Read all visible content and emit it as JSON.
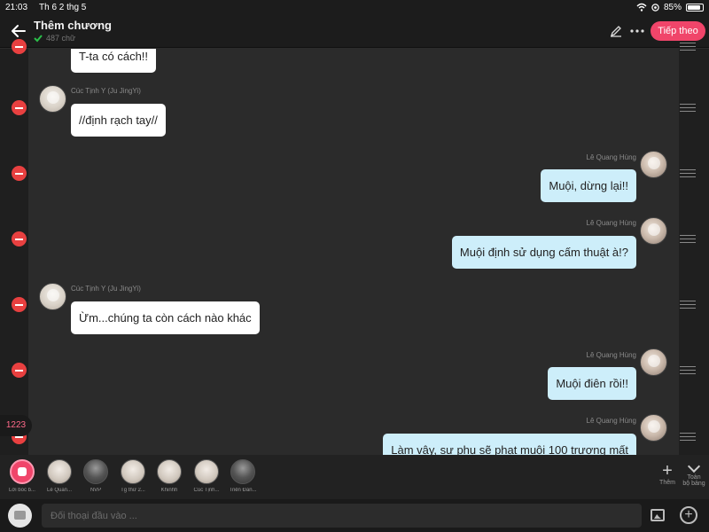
{
  "status_bar": {
    "time": "21:03",
    "date": "Th 6 2 thg 5",
    "battery": "85%"
  },
  "header": {
    "title": "Thêm chương",
    "word_count": "487 chữ",
    "next_label": "Tiếp theo"
  },
  "chat": {
    "messages": [
      {
        "side": "left",
        "speaker": "",
        "text": "T-ta có cách!!"
      },
      {
        "side": "left",
        "speaker": "Cúc Tịnh Y (Ju JingYi)",
        "text": "//định rạch tay//"
      },
      {
        "side": "right",
        "speaker": "Lê Quang Hùng",
        "text": "Muội, dừng lại!!"
      },
      {
        "side": "right",
        "speaker": "Lê Quang Hùng",
        "text": "Muội định sử dụng cấm thuật à!?"
      },
      {
        "side": "left",
        "speaker": "Cúc Tịnh Y (Ju JingYi)",
        "text": "Ừm...chúng ta còn cách nào khác"
      },
      {
        "side": "right",
        "speaker": "Lê Quang Hùng",
        "text": "Muội điên rồi!!"
      },
      {
        "side": "right",
        "speaker": "Lê Quang Hùng",
        "text": "Làm vậy, sư phụ sẽ phạt muội 100 trượng mất"
      }
    ],
    "counter_badge": "1223"
  },
  "characters": [
    {
      "label": "Lời bốc b..."
    },
    {
      "label": "Lê Quan..."
    },
    {
      "label": "NVP"
    },
    {
      "label": "Tg thứ 2..."
    },
    {
      "label": "Khinhh"
    },
    {
      "label": "Cúc Tịnh..."
    },
    {
      "label": "Triển Đán..."
    }
  ],
  "character_actions": {
    "add_label": "Thêm",
    "all_label_1": "Toàn",
    "all_label_2": "bộ bảng"
  },
  "input": {
    "placeholder": "Đối thoại đầu vào ..."
  },
  "colors": {
    "accent": "#f0456a",
    "delete": "#e84040",
    "right_bubble": "#cdeefa",
    "left_bubble": "#ffffff"
  }
}
